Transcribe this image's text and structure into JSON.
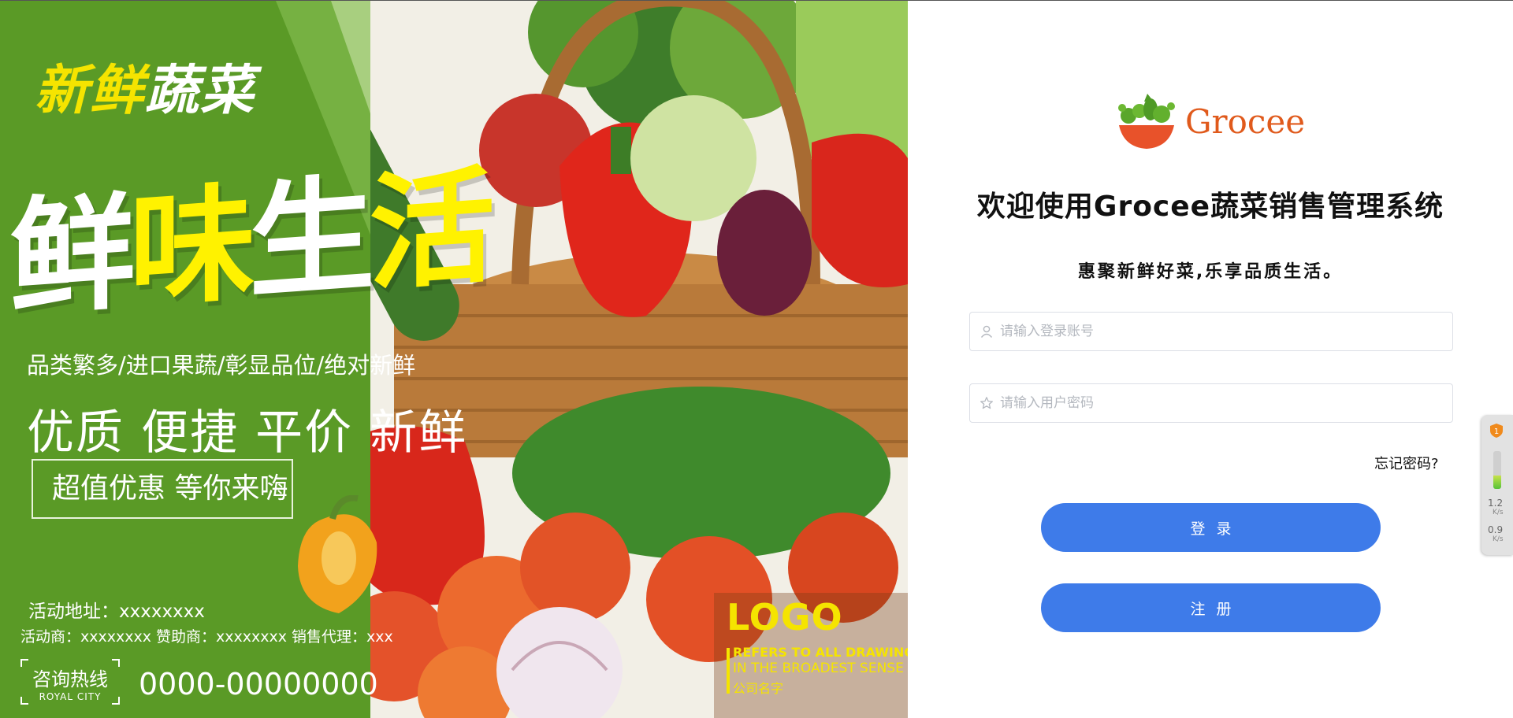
{
  "banner": {
    "headline_small_1": "新鲜",
    "headline_small_2": "蔬菜",
    "headline_big_1": "鲜",
    "headline_big_2": "味",
    "headline_big_3": "生",
    "headline_big_4": "活",
    "slogan_1": "品类繁多/进口果蔬/彰显品位/绝对新鲜",
    "slogan_2": "优质 便捷 平价  新鲜",
    "promo": "超值优惠 等你来嗨",
    "address": "活动地址：xxxxxxxx",
    "sponsors": "活动商：xxxxxxxx 赞助商：xxxxxxxx 销售代理：xxx",
    "hotline_label": "咨询热线",
    "hotline_sub": "ROYAL CITY",
    "phone": "0000-00000000",
    "logo_text": "LOGO",
    "logo_line_1": "REFERS TO ALL DRAWINGS",
    "logo_line_2": "IN THE BROADEST SENSE",
    "logo_line_3": "公司名字"
  },
  "login": {
    "brand_name": "Grocee",
    "title": "欢迎使用Grocee蔬菜销售管理系统",
    "subtitle": "惠聚新鲜好菜,乐享品质生活。",
    "account_placeholder": "请输入登录账号",
    "password_placeholder": "请输入用户密码",
    "forgot_label": "忘记密码?",
    "login_label": "登录",
    "register_label": "注册"
  },
  "widget": {
    "badge": "1",
    "upload_speed": "1.2",
    "download_speed": "0.9",
    "unit": "K/s",
    "level": 0.35
  },
  "colors": {
    "primary": "#3e7be9",
    "banner_green": "#5a9a26",
    "brand_orange": "#e05a1c",
    "headline_yellow": "#fff200"
  }
}
